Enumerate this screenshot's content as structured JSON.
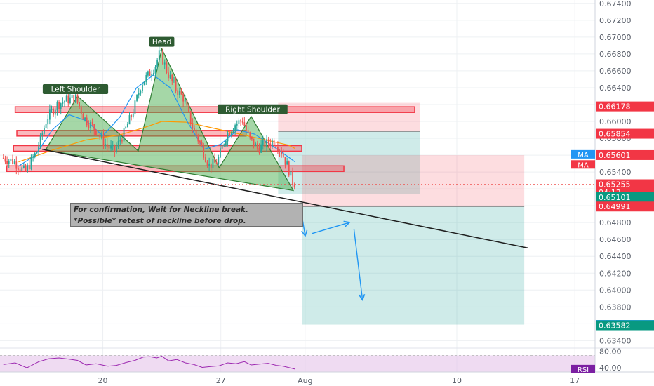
{
  "chart_data": {
    "type": "candlestick",
    "y_axis": {
      "ticks": [
        "0.67400",
        "0.67200",
        "0.67000",
        "0.66800",
        "0.66600",
        "0.66400",
        "0.66200",
        "0.66000",
        "0.65800",
        "0.65600",
        "0.65400",
        "0.65200",
        "0.65000",
        "0.64800",
        "0.64600",
        "0.64400",
        "0.64200",
        "0.64000",
        "0.63800",
        "0.63600",
        "0.63400"
      ],
      "range": [
        0.6332,
        0.6744
      ]
    },
    "x_axis": {
      "ticks": [
        {
          "label": "20",
          "day": 20
        },
        {
          "label": "27",
          "day": 27
        },
        {
          "label": "Aug",
          "day": 32
        },
        {
          "label": "10",
          "day": 41
        },
        {
          "label": "17",
          "day": 48
        }
      ],
      "range": [
        13.9,
        49.2
      ]
    },
    "pattern_labels": {
      "left_shoulder": "Left Shoulder",
      "head": "Head",
      "right_shoulder": "Right Shoulder"
    },
    "pattern_points": [
      [
        16.6,
        0.6566
      ],
      [
        18.5,
        0.663
      ],
      [
        22.1,
        0.6565
      ],
      [
        23.5,
        0.6686
      ],
      [
        26.9,
        0.6545
      ],
      [
        28.8,
        0.6606
      ],
      [
        31.3,
        0.6518
      ]
    ],
    "neckline": {
      "from": [
        16.4,
        0.6567
      ],
      "to": [
        45.2,
        0.645
      ]
    },
    "zones": [
      {
        "from_day": 14.8,
        "to_day": 38.5,
        "price": 0.6614
      },
      {
        "from_day": 14.3,
        "to_day": 34.3,
        "price": 0.6544
      },
      {
        "from_day": 14.9,
        "to_day": 28.5,
        "price": 0.6586
      },
      {
        "from_day": 14.7,
        "to_day": 31.8,
        "price": 0.6568
      }
    ],
    "positions": [
      {
        "from_day": 30.4,
        "to_day": 38.8,
        "entry": 0.6588,
        "stop": 0.6622,
        "target": 0.6514
      },
      {
        "from_day": 31.8,
        "to_day": 45.0,
        "entry": 0.6499,
        "stop": 0.656,
        "target": 0.6359
      }
    ],
    "arrows": [
      {
        "from": [
          31.8,
          0.6489
        ],
        "to": [
          32.0,
          0.6465
        ]
      },
      {
        "from": [
          32.4,
          0.6467
        ],
        "to": [
          34.6,
          0.648
        ]
      },
      {
        "from": [
          34.9,
          0.6472
        ],
        "to": [
          35.4,
          0.6389
        ]
      }
    ],
    "price_labels": [
      {
        "text": "0.66178",
        "price": 0.66178,
        "color": "#f23645"
      },
      {
        "text": "0.65854",
        "price": 0.65854,
        "color": "#f23645"
      },
      {
        "text": "0.65601",
        "price": 0.65601,
        "color": "#f23645"
      },
      {
        "text": "0.65255",
        "price": 0.65255,
        "color": "#f23645"
      },
      {
        "text": "04:13",
        "price": 0.6516,
        "color": "#f23645"
      },
      {
        "text": "0.65101",
        "price": 0.65101,
        "color": "#089981"
      },
      {
        "text": "0.64991",
        "price": 0.64991,
        "color": "#f23645"
      },
      {
        "text": "0.63586",
        "price": 0.63586,
        "color": "#2196f3"
      },
      {
        "text": "0.63582",
        "price": 0.63582,
        "color": "#089981"
      }
    ],
    "ma_labels": [
      {
        "text": "MA",
        "price": 0.6561,
        "color": "#2196f3"
      },
      {
        "text": "MA",
        "price": 0.6549,
        "color": "#f23645"
      }
    ],
    "rsi": {
      "label": "RSI",
      "ticks": [
        "80.00",
        "40.00"
      ],
      "range": [
        30,
        86
      ],
      "upper": 70,
      "lower": 30
    },
    "ma_fast": [
      [
        15,
        0.6547
      ],
      [
        16,
        0.656
      ],
      [
        17,
        0.659
      ],
      [
        18,
        0.6608
      ],
      [
        19,
        0.6601
      ],
      [
        20,
        0.6583
      ],
      [
        21,
        0.6605
      ],
      [
        22,
        0.664
      ],
      [
        23,
        0.6655
      ],
      [
        24,
        0.664
      ],
      [
        25,
        0.66
      ],
      [
        26,
        0.6567
      ],
      [
        27,
        0.6573
      ],
      [
        28,
        0.659
      ],
      [
        29,
        0.6585
      ],
      [
        30,
        0.6572
      ],
      [
        31,
        0.6558
      ],
      [
        31.4,
        0.6552
      ]
    ],
    "ma_slow": [
      [
        15,
        0.6552
      ],
      [
        17,
        0.6566
      ],
      [
        19,
        0.6578
      ],
      [
        21,
        0.6584
      ],
      [
        22.5,
        0.6593
      ],
      [
        23.5,
        0.66
      ],
      [
        25,
        0.6599
      ],
      [
        27,
        0.659
      ],
      [
        29,
        0.6581
      ],
      [
        31,
        0.6572
      ],
      [
        31.4,
        0.6568
      ]
    ],
    "price_path": [
      [
        14.1,
        0.6557
      ],
      [
        14.8,
        0.6553
      ],
      [
        15.5,
        0.654
      ],
      [
        16.2,
        0.6565
      ],
      [
        16.8,
        0.6604
      ],
      [
        17.4,
        0.662
      ],
      [
        18.0,
        0.6626
      ],
      [
        18.5,
        0.6628
      ],
      [
        19.0,
        0.6604
      ],
      [
        19.6,
        0.6592
      ],
      [
        20.3,
        0.6572
      ],
      [
        20.8,
        0.6565
      ],
      [
        21.4,
        0.6588
      ],
      [
        21.9,
        0.6612
      ],
      [
        22.4,
        0.6645
      ],
      [
        22.8,
        0.6655
      ],
      [
        23.2,
        0.6665
      ],
      [
        23.5,
        0.6683
      ],
      [
        23.9,
        0.666
      ],
      [
        24.4,
        0.664
      ],
      [
        24.9,
        0.6628
      ],
      [
        25.4,
        0.6595
      ],
      [
        25.9,
        0.6573
      ],
      [
        26.4,
        0.6548
      ],
      [
        26.9,
        0.6552
      ],
      [
        27.4,
        0.6582
      ],
      [
        27.9,
        0.6596
      ],
      [
        28.4,
        0.6602
      ],
      [
        28.8,
        0.658
      ],
      [
        29.3,
        0.6568
      ],
      [
        29.8,
        0.6574
      ],
      [
        30.3,
        0.6577
      ],
      [
        30.7,
        0.6565
      ],
      [
        31.1,
        0.6545
      ],
      [
        31.4,
        0.6527
      ]
    ],
    "rsi_values": [
      [
        14.1,
        48
      ],
      [
        14.8,
        52
      ],
      [
        15.5,
        40
      ],
      [
        16.2,
        55
      ],
      [
        16.8,
        62
      ],
      [
        17.4,
        64
      ],
      [
        18.0,
        61
      ],
      [
        18.5,
        58
      ],
      [
        19.0,
        47
      ],
      [
        19.6,
        50
      ],
      [
        20.3,
        44
      ],
      [
        20.8,
        46
      ],
      [
        21.4,
        53
      ],
      [
        21.9,
        58
      ],
      [
        22.4,
        66
      ],
      [
        22.8,
        67
      ],
      [
        23.2,
        64
      ],
      [
        23.5,
        68
      ],
      [
        23.9,
        57
      ],
      [
        24.4,
        60
      ],
      [
        24.9,
        52
      ],
      [
        25.4,
        48
      ],
      [
        25.9,
        41
      ],
      [
        26.4,
        43
      ],
      [
        26.9,
        45
      ],
      [
        27.4,
        52
      ],
      [
        27.9,
        50
      ],
      [
        28.4,
        55
      ],
      [
        28.8,
        47
      ],
      [
        29.3,
        49
      ],
      [
        29.8,
        51
      ],
      [
        30.3,
        46
      ],
      [
        30.7,
        44
      ],
      [
        31.1,
        40
      ],
      [
        31.4,
        37
      ]
    ]
  },
  "annotation": {
    "line1": "For confirmation, Wait for Neckline break.",
    "line2": "*Possible* retest of neckline before drop."
  },
  "colors": {
    "up": "#26a69a",
    "down": "#ef5350",
    "pattern_fill": "#4caf50",
    "zone": "#f23645",
    "profit": "#26a69a",
    "loss": "#f23645",
    "ma_fast": "#2196f3",
    "ma_slow": "#ff9800",
    "rsi_line": "#9c27b0",
    "rsi_band": "#e1bee7",
    "arrow": "#2196f3",
    "neckline": "#1e1e1e",
    "label_bg": "#2e5b32"
  }
}
